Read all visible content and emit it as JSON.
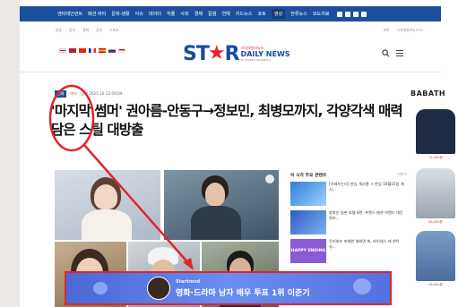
{
  "topnav": {
    "items": [
      "엔터테인먼트",
      "패션·뷰티",
      "문화·생활",
      "이슈",
      "데이터",
      "히플",
      "사회",
      "경제",
      "칼럼",
      "연예",
      "키드뉴스",
      "포토",
      "영상",
      "한류뉴스",
      "보도자료"
    ],
    "active_index": 12
  },
  "subbar": {
    "left": [
      "방송",
      "음악",
      "영화",
      "공연",
      "스포츠"
    ],
    "right": [
      "포토",
      "스타데일리뉴스TV"
    ]
  },
  "logo": {
    "text_st": "ST",
    "text_r": "R",
    "kor": "스타데일리뉴스",
    "daily": "DAILY NEWS",
    "tagline": "BY STARTS INDONESIA"
  },
  "article": {
    "category": "연예",
    "meta": "입력 2025.10.13 09:09",
    "author": "박수",
    "headline": "'마지막 썸머' 권아름-안동구→정보민, 최병모까지, 각양각색 매력 담은 스틸 대방출"
  },
  "popular": {
    "title": "이 시각 주요 콘텐츠",
    "more": "더보기",
    "items": [
      {
        "text": "[유레브는리] 한입 개시됐 그 한입 10월15일 개시..."
      },
      {
        "text": "창밖은 일본 호텔 8면, 프렌스 패션 브랜드 대단 화보..."
      },
      {
        "text": "킨키보즈 마제한 해외면 최, 라이센스 에 한탁 유..."
      }
    ],
    "thumb_label": "HAPPY ENDING"
  },
  "ad": {
    "brand": "BABATH",
    "prices": [
      "72,000원",
      "68,000원",
      "98,000원"
    ]
  },
  "banner": {
    "logo": "Startrend",
    "message": "영화·드라마 남자 배우 투표",
    "rank": "1위 이준기"
  },
  "colors": {
    "nav": "#1c4f9c",
    "banner_border": "#e0252b",
    "banner_bg": "#5a78e6"
  }
}
